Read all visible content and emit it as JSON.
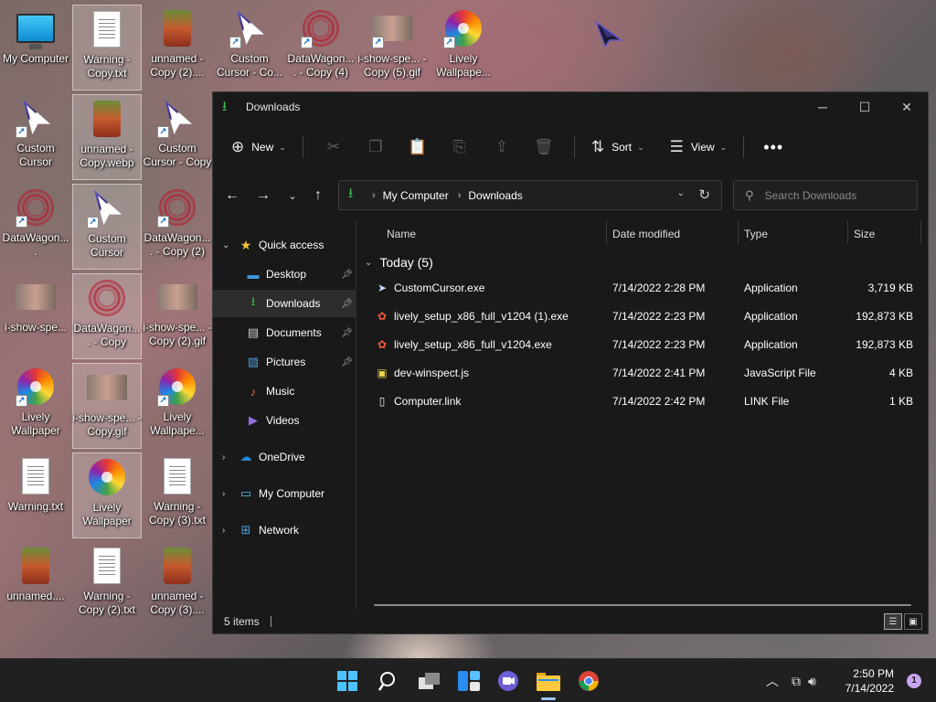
{
  "desktop": {
    "icons": [
      {
        "label": "My Computer",
        "kind": "monitor"
      },
      {
        "label": "Warning - Copy.txt",
        "kind": "doc"
      },
      {
        "label": "unnamed - Copy (2)....",
        "kind": "fox"
      },
      {
        "label": "Custom Cursor - Co...",
        "kind": "cursor"
      },
      {
        "label": "DataWagon.... - Copy (4)",
        "kind": "web"
      },
      {
        "label": "i-show-spe... - Copy (5).gif",
        "kind": "gif"
      },
      {
        "label": "Lively Wallpape...",
        "kind": "flower"
      },
      {
        "label": "Custom Cursor",
        "kind": "cursor"
      },
      {
        "label": "unnamed - Copy.webp",
        "kind": "fox"
      },
      {
        "label": "Custom Cursor - Copy",
        "kind": "cursor"
      },
      {
        "label": "DataWagon....",
        "kind": "web"
      },
      {
        "label": "Custom Cursor",
        "kind": "cursor"
      },
      {
        "label": "DataWagon.... - Copy (2)",
        "kind": "web"
      },
      {
        "label": "i-show-spe...",
        "kind": "gif"
      },
      {
        "label": "DataWagon.... - Copy",
        "kind": "web"
      },
      {
        "label": "i-show-spe... - Copy (2).gif",
        "kind": "gif"
      },
      {
        "label": "Lively Wallpaper",
        "kind": "flower"
      },
      {
        "label": "i-show-spe... - Copy.gif",
        "kind": "gif"
      },
      {
        "label": "Lively Wallpape...",
        "kind": "flower"
      },
      {
        "label": "Warning.txt",
        "kind": "doc"
      },
      {
        "label": "Lively Wallpaper",
        "kind": "flower"
      },
      {
        "label": "Warning - Copy (3).txt",
        "kind": "doc"
      },
      {
        "label": "unnamed....",
        "kind": "fox"
      },
      {
        "label": "Warning - Copy (2).txt",
        "kind": "doc"
      },
      {
        "label": "unnamed - Copy (3)....",
        "kind": "fox"
      }
    ]
  },
  "explorer": {
    "title": "Downloads",
    "toolbar": {
      "new_label": "New",
      "sort_label": "Sort",
      "view_label": "View",
      "more_label": "•••"
    },
    "address": {
      "crumbs": [
        "My Computer",
        "Downloads"
      ]
    },
    "search": {
      "placeholder": "Search Downloads"
    },
    "sidebar": {
      "quick_access": "Quick access",
      "items": [
        {
          "label": "Desktop",
          "icon": "desktop-icon",
          "pinned": true
        },
        {
          "label": "Downloads",
          "icon": "downloads-icon",
          "pinned": true,
          "active": true
        },
        {
          "label": "Documents",
          "icon": "documents-icon",
          "pinned": true
        },
        {
          "label": "Pictures",
          "icon": "pictures-icon",
          "pinned": true
        },
        {
          "label": "Music",
          "icon": "music-icon",
          "pinned": false
        },
        {
          "label": "Videos",
          "icon": "videos-icon",
          "pinned": false
        }
      ],
      "onedrive": "OneDrive",
      "my_computer": "My Computer",
      "network": "Network"
    },
    "columns": {
      "name": "Name",
      "date": "Date modified",
      "type": "Type",
      "size": "Size"
    },
    "group": {
      "label": "Today (5)"
    },
    "files": [
      {
        "name": "CustomCursor.exe",
        "date": "7/14/2022 2:28 PM",
        "type": "Application",
        "size": "3,719 KB",
        "icon": "cursor-app-icon"
      },
      {
        "name": "lively_setup_x86_full_v1204 (1).exe",
        "date": "7/14/2022 2:23 PM",
        "type": "Application",
        "size": "192,873 KB",
        "icon": "lively-icon"
      },
      {
        "name": "lively_setup_x86_full_v1204.exe",
        "date": "7/14/2022 2:23 PM",
        "type": "Application",
        "size": "192,873 KB",
        "icon": "lively-icon"
      },
      {
        "name": "dev-winspect.js",
        "date": "7/14/2022 2:41 PM",
        "type": "JavaScript File",
        "size": "4 KB",
        "icon": "js-file-icon"
      },
      {
        "name": "Computer.link",
        "date": "7/14/2022 2:42 PM",
        "type": "LINK File",
        "size": "1 KB",
        "icon": "file-icon"
      }
    ],
    "status": {
      "items_count": "5 items"
    }
  },
  "taskbar": {
    "apps": [
      "start-icon",
      "search-icon",
      "task-view-icon",
      "widgets-icon",
      "chat-icon",
      "file-explorer-icon",
      "chrome-icon"
    ],
    "clock": {
      "time": "2:50 PM",
      "date": "7/14/2022"
    },
    "notifications": "1"
  }
}
